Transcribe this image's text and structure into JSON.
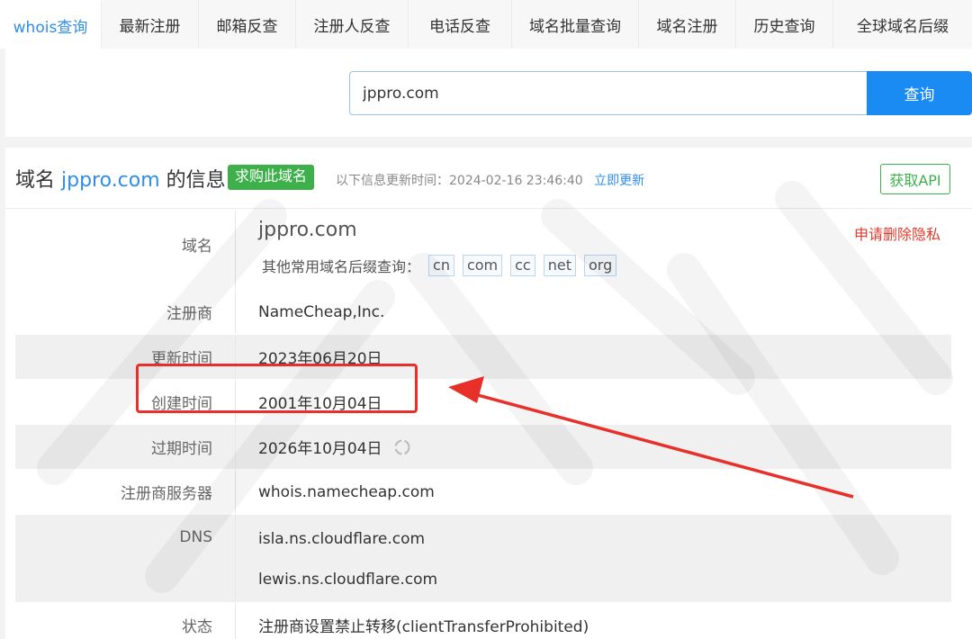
{
  "tabs": [
    {
      "label": "whois查询",
      "active": true
    },
    {
      "label": "最新注册"
    },
    {
      "label": "邮箱反查"
    },
    {
      "label": "注册人反查"
    },
    {
      "label": "电话反查"
    },
    {
      "label": "域名批量查询"
    },
    {
      "label": "域名注册"
    },
    {
      "label": "历史查询"
    },
    {
      "label": "全球域名后缀"
    }
  ],
  "search": {
    "value": "jppro.com",
    "button_label": "查询"
  },
  "card": {
    "title_prefix": "域名",
    "title_domain": "jppro.com",
    "title_suffix": "的信息",
    "buy_label": "求购此域名",
    "update_label": "以下信息更新时间：2024-02-16 23:46:40",
    "refresh_label": "立即更新",
    "api_label": "获取API"
  },
  "domain_row": {
    "label": "域名",
    "value": "jppro.com",
    "privacy_label": "申请删除隐私",
    "suffix_prompt": "其他常用域名后缀查询：",
    "suffixes": [
      "cn",
      "com",
      "cc",
      "net",
      "org"
    ]
  },
  "rows": {
    "registrar": {
      "label": "注册商",
      "value": "NameCheap,Inc."
    },
    "updated": {
      "label": "更新时间",
      "value": "2023年06月20日"
    },
    "created": {
      "label": "创建时间",
      "value": "2001年10月04日"
    },
    "expires": {
      "label": "过期时间",
      "value": "2026年10月04日"
    },
    "whois_server": {
      "label": "注册商服务器",
      "value": "whois.namecheap.com"
    },
    "dns": {
      "label": "DNS",
      "values": [
        "isla.ns.cloudflare.com",
        "lewis.ns.cloudflare.com"
      ]
    },
    "status": {
      "label": "状态",
      "value": "注册商设置禁止转移(clientTransferProhibited)"
    }
  },
  "colors": {
    "accent": "#2f8eea",
    "buy_green": "#3db04a",
    "annotation_red": "#e8302a"
  },
  "icons": {
    "refresh_spinner": "refresh-spinner-icon"
  }
}
